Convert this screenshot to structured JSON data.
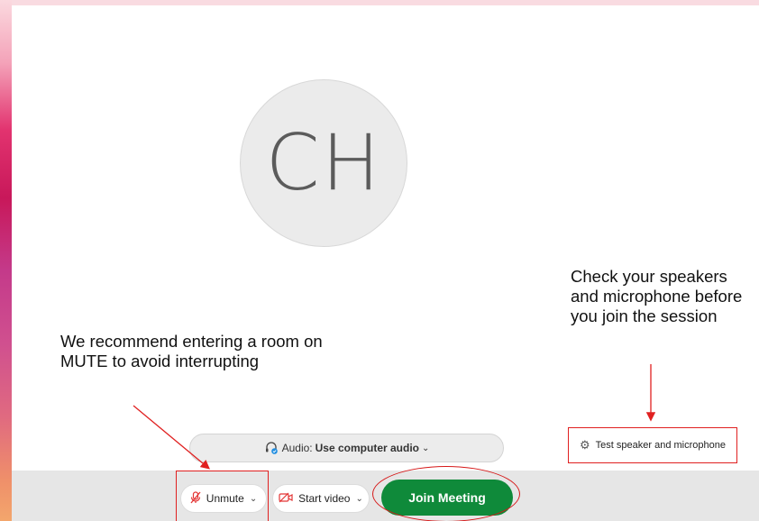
{
  "avatar": {
    "initials": "CH"
  },
  "annotations": {
    "mute_note": "We recommend entering a room on MUTE to avoid interrupting",
    "test_note": "Check your speakers and microphone before you join the session"
  },
  "audio": {
    "label": "Audio:",
    "value": "Use computer audio",
    "chevron": "⌄",
    "icon": "headset-icon"
  },
  "test_speaker": {
    "label": "Test speaker and microphone",
    "icon": "gear-icon"
  },
  "controls": {
    "unmute_label": "Unmute",
    "unmute_icon": "muted-mic-icon",
    "video_label": "Start video",
    "video_icon": "video-off-icon",
    "join_label": "Join Meeting"
  },
  "colors": {
    "join_button": "#0f8a3a",
    "annotation_red": "#e02020",
    "avatar_bg": "#ebebeb"
  }
}
